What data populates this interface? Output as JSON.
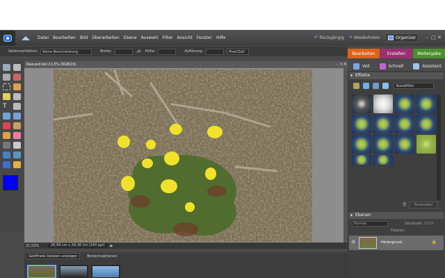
{
  "menubar": {
    "items": [
      "Datei",
      "Bearbeiten",
      "Bild",
      "Überarbeiten",
      "Ebene",
      "Auswahl",
      "Filter",
      "Ansicht",
      "Fenster",
      "Hilfe"
    ],
    "undo_label": "Rückgängig",
    "redo_label": "Wiederholen",
    "organizer_label": "Organizer"
  },
  "options_bar": {
    "aspect_label": "Seitenverhältnis:",
    "aspect_value": "Keine Beschränkung",
    "width_label": "Breite:",
    "height_label": "Höhe:",
    "resolution_label": "Auflösung:",
    "resolution_unit": "Pixel/Zoll"
  },
  "mode_tabs": [
    {
      "label": "Bearbeiten",
      "color": "#e0621c"
    },
    {
      "label": "Erstellen",
      "color": "#9b2f73"
    },
    {
      "label": "Weitergabe",
      "color": "#4c8f2f"
    }
  ],
  "edit_tabs": [
    "Voll",
    "Schnell",
    "Assistent"
  ],
  "document": {
    "title": "Raw.psd bei 21,5% (RGB/16)",
    "zoom": "21,53%",
    "dimensions": "26,58 cm x 34,38 cm (240 ppi)"
  },
  "project_bin": {
    "show_label": "Geöffnete Dateien anzeigen",
    "actions_label": "Bereichsaktionen"
  },
  "effects_panel": {
    "title": "Effekte",
    "filter_select": "Kunstfilter",
    "apply_label": "Anwenden"
  },
  "layers_panel": {
    "title": "Ebenen",
    "blend_mode": "Normal",
    "opacity_label": "Deckkraft:",
    "opacity_value": "100%",
    "lock_label": "Fixieren:",
    "layer_name": "Hintergrund"
  },
  "colors": {
    "foreground": "#0000ff",
    "background": "#ffffff"
  }
}
